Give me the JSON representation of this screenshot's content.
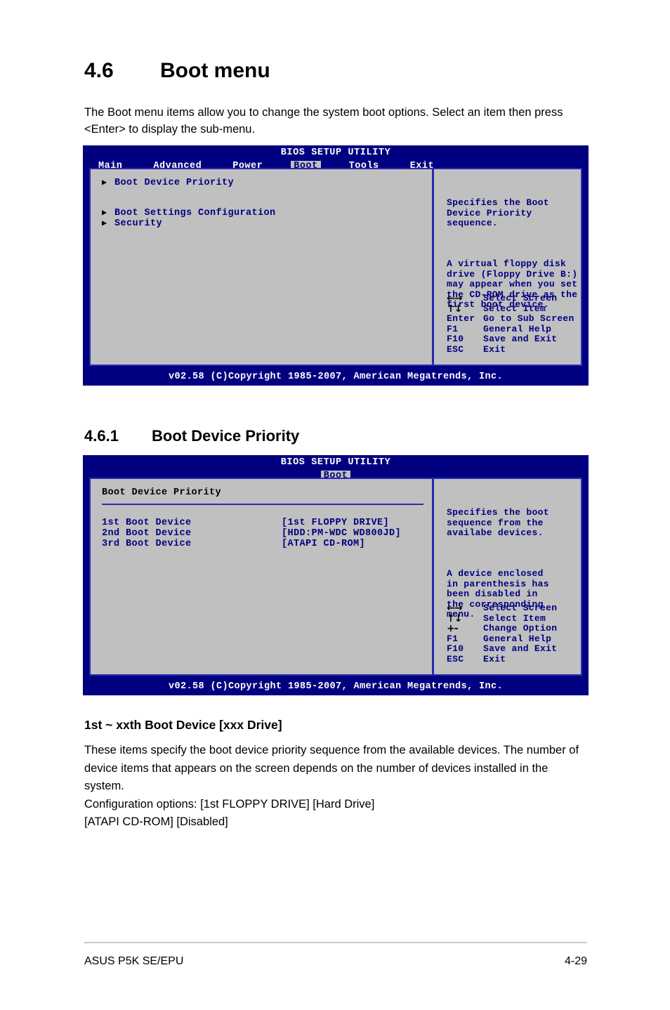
{
  "document": {
    "section": {
      "number": "4.6",
      "title": "Boot menu"
    },
    "intro": "The Boot menu items allow you to change the system boot options. Select an item then press <Enter> to display the sub-menu.",
    "subsection": {
      "number": "4.6.1",
      "title": "Boot Device Priority"
    },
    "item_heading": "1st ~ xxth Boot Device [xxx Drive]",
    "item_body_1": "These items specify the boot device priority sequence from the available devices. The number of device items that appears on the screen depends on the number of devices installed in the system.",
    "item_body_2": "Configuration options: [1st FLOPPY DRIVE] [Hard Drive]",
    "item_body_3": "[ATAPI CD-ROM] [Disabled]",
    "footer_left": "ASUS P5K SE/EPU",
    "footer_right": "4-29"
  },
  "bios_screen_1": {
    "title": "BIOS SETUP UTILITY",
    "tabs": [
      {
        "label": "Main",
        "active": false
      },
      {
        "label": "Advanced",
        "active": false
      },
      {
        "label": "Power",
        "active": false
      },
      {
        "label": "Boot",
        "active": true
      },
      {
        "label": "Tools",
        "active": false
      },
      {
        "label": "Exit",
        "active": false
      }
    ],
    "menu_items": [
      {
        "label": "Boot Device Priority",
        "arrow": "▶"
      },
      {
        "label": "Boot Settings Configuration",
        "arrow": "▶"
      },
      {
        "label": "Security",
        "arrow": "▶"
      }
    ],
    "help_paragraphs": [
      "Specifies the Boot\nDevice Priority\nsequence.",
      "A virtual floppy disk\ndrive (Floppy Drive B:)\nmay appear when you set\nthe CD-ROM drive as the\nfirst boot device."
    ],
    "legend": [
      {
        "key": "←→",
        "desc": "Select Screen",
        "glyph": true
      },
      {
        "key": "↑↓",
        "desc": "Select Item",
        "glyph": true
      },
      {
        "key": "Enter",
        "desc": "Go to Sub Screen",
        "glyph": false
      },
      {
        "key": "F1",
        "desc": "General Help",
        "glyph": false
      },
      {
        "key": "F10",
        "desc": "Save and Exit",
        "glyph": false
      },
      {
        "key": "ESC",
        "desc": "Exit",
        "glyph": false
      }
    ],
    "footer": "v02.58 (C)Copyright 1985-2007, American Megatrends, Inc."
  },
  "bios_screen_2": {
    "title": "BIOS SETUP UTILITY",
    "tabs": [
      {
        "label": "Boot",
        "active": true
      }
    ],
    "panel_title": "Boot Device Priority",
    "devices": [
      {
        "name": "1st Boot Device",
        "value": "[1st FLOPPY DRIVE]"
      },
      {
        "name": "2nd Boot Device",
        "value": "[HDD:PM-WDC WD800JD]"
      },
      {
        "name": "3rd Boot Device",
        "value": "[ATAPI CD-ROM]"
      }
    ],
    "help_paragraphs": [
      "Specifies the boot\nsequence from the\navailabe devices.",
      "A device enclosed\nin parenthesis has\nbeen disabled in\nthe corresponding\nmenu."
    ],
    "legend": [
      {
        "key": "←→",
        "desc": "Select Screen",
        "glyph": true
      },
      {
        "key": "↑↓",
        "desc": "Select Item",
        "glyph": true
      },
      {
        "key": "+-",
        "desc": "Change Option",
        "glyph": true
      },
      {
        "key": "F1",
        "desc": "General Help",
        "glyph": false
      },
      {
        "key": "F10",
        "desc": "Save and Exit",
        "glyph": false
      },
      {
        "key": "ESC",
        "desc": "Exit",
        "glyph": false
      }
    ],
    "footer": "v02.58 (C)Copyright 1985-2007, American Megatrends, Inc."
  },
  "colors": {
    "bios_blue": "#000080",
    "panel_gray": "#c0c0c0",
    "border_blue": "#2a2ab0",
    "text_white": "#ffffff"
  }
}
